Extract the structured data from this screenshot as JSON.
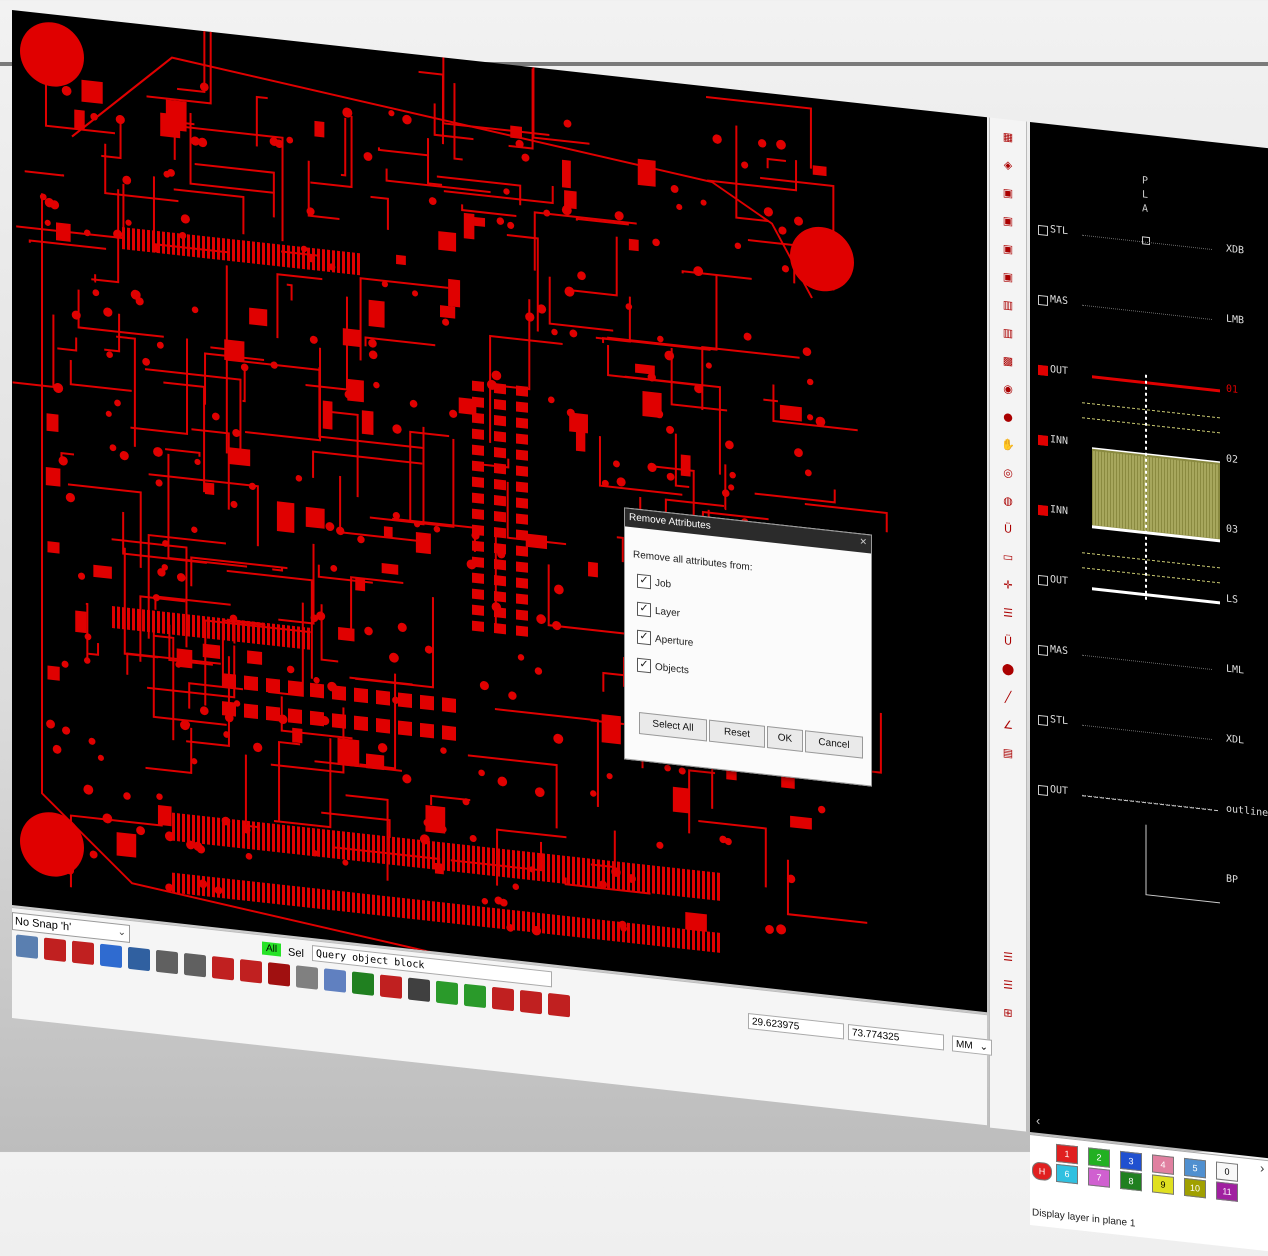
{
  "colors": {
    "trace": "#e00000",
    "board_bg": "#000000",
    "snap_all": "#27e227"
  },
  "snap": {
    "value": "No Snap 'h'"
  },
  "toolbar": {
    "all_label": "All",
    "sel_label": "Sel",
    "query_text": "Query object block",
    "icons": [
      "cad-icon",
      "pin-icon",
      "pin-icon",
      "net-icon",
      "bus-icon",
      "net-compare-icon",
      "pad-compare-icon",
      "drc-icon",
      "resistor-icon",
      "drop-icon",
      "camera-icon",
      "gem-icon",
      "grid-icon",
      "pad-icon",
      "tree-icon",
      "board-icon",
      "board-icon",
      "board-icon",
      "board-icon",
      "board-icon"
    ]
  },
  "coords": {
    "x": "29.623975",
    "y": "73.774325",
    "unit": "MM"
  },
  "dialog": {
    "title": "Remove Attributes",
    "prompt": "Remove all attributes from:",
    "options": [
      {
        "label": "Job",
        "checked": true
      },
      {
        "label": "Layer",
        "checked": true
      },
      {
        "label": "Aperture",
        "checked": true
      },
      {
        "label": "Objects",
        "checked": true
      }
    ],
    "buttons": {
      "select_all": "Select All",
      "reset": "Reset",
      "ok": "OK",
      "cancel": "Cancel"
    }
  },
  "layer_stack": {
    "header_letters": "PLA",
    "rows": [
      {
        "left": "STL",
        "right": "XDB",
        "active": false
      },
      {
        "left": "MAS",
        "right": "LMB",
        "active": false
      },
      {
        "left": "OUT",
        "right": "01",
        "active": true
      },
      {
        "left": "INN",
        "right": "02",
        "active": true
      },
      {
        "left": "INN",
        "right": "03",
        "active": true
      },
      {
        "left": "OUT",
        "right": "LS",
        "active": false
      },
      {
        "left": "MAS",
        "right": "LML",
        "active": false
      },
      {
        "left": "STL",
        "right": "XDL",
        "active": false
      },
      {
        "left": "OUT",
        "right": "outline",
        "active": false
      },
      {
        "left": "",
        "right": "BP",
        "active": false
      }
    ]
  },
  "palette": {
    "chips": [
      {
        "label": "1",
        "color": "#e02020"
      },
      {
        "label": "2",
        "color": "#22b022"
      },
      {
        "label": "3",
        "color": "#2050d0"
      },
      {
        "label": "4",
        "color": "#e080a0"
      },
      {
        "label": "5",
        "color": "#5090d0"
      },
      {
        "label": "0",
        "color": "#f8f8f8"
      },
      {
        "label": "6",
        "color": "#30c0e0"
      },
      {
        "label": "7",
        "color": "#d060d0"
      },
      {
        "label": "8",
        "color": "#208020"
      },
      {
        "label": "9",
        "color": "#e0e020"
      },
      {
        "label": "10",
        "color": "#a0a000"
      },
      {
        "label": "11",
        "color": "#a020a0"
      }
    ],
    "status": "Display layer in plane 1"
  }
}
